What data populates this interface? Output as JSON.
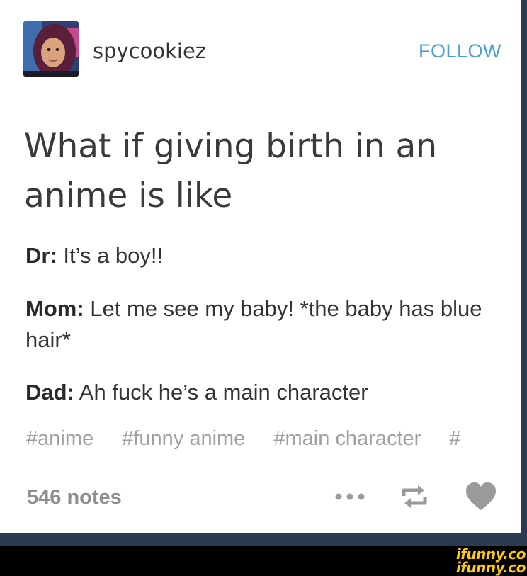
{
  "post": {
    "username": "spycookiez",
    "follow_label": "FOLLOW",
    "title": "What if giving birth in an anime is like",
    "lines": [
      {
        "speaker": "Dr:",
        "text": " It’s a boy!!"
      },
      {
        "speaker": "Mom:",
        "text": " Let me see my baby! *the baby has blue hair*"
      },
      {
        "speaker": "Dad:",
        "text": " Ah fuck he’s a main character"
      }
    ],
    "tags": [
      "#anime",
      "#funny anime",
      "#main character",
      "#"
    ],
    "notes": "546 notes"
  },
  "watermark": {
    "line1": "ifunny.co",
    "line2": "ifunny.co"
  },
  "colors": {
    "accent": "#4a9fd0",
    "tag": "#a0a0a0",
    "icon": "#9a9a9a",
    "watermark": "#ffcc00"
  }
}
